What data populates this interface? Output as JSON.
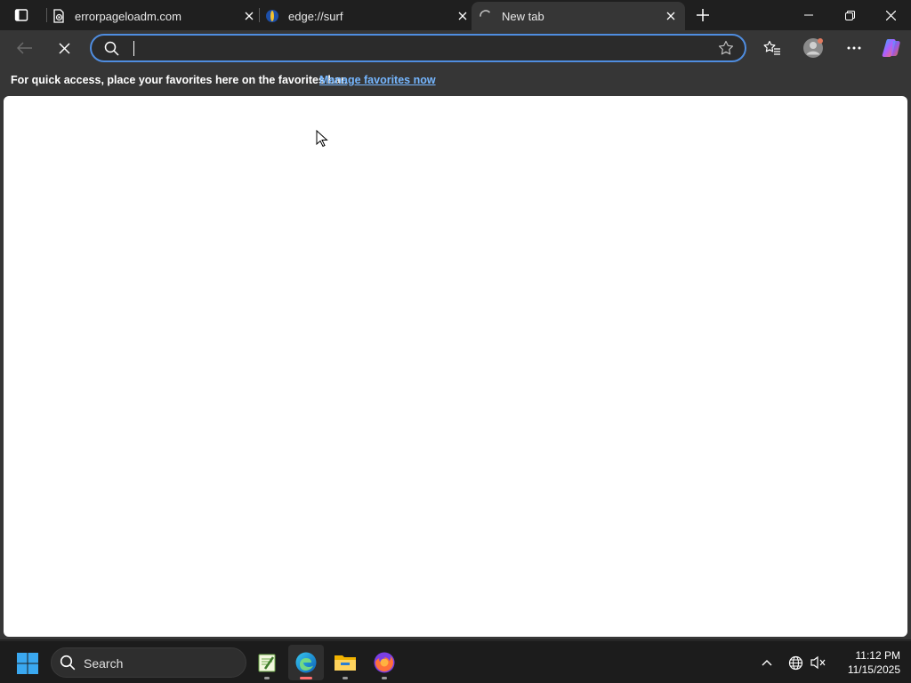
{
  "tabs": [
    {
      "title": "errorpageloadm.com",
      "favicon": "error-page-icon",
      "active": false
    },
    {
      "title": "edge://surf",
      "favicon": "surf-game-icon",
      "active": false
    },
    {
      "title": "New tab",
      "favicon": "loading-spinner-icon",
      "active": true
    }
  ],
  "toolbar": {
    "address_value": "",
    "back_icon": "back-arrow-icon",
    "stop_icon": "stop-loading-icon"
  },
  "favorites_bar": {
    "message": "For quick access, place your favorites here on the favorites bar.",
    "link": "Manage favorites now"
  },
  "taskbar": {
    "search_label": "Search",
    "apps": [
      "notepad-plus-icon",
      "edge-icon",
      "file-explorer-icon",
      "firefox-icon"
    ],
    "time": "11:12 PM",
    "date": "11/15/2025"
  },
  "colors": {
    "accent": "#4f8de0",
    "link": "#75b6ff",
    "tab_active": "#363636",
    "chrome_bg": "#1f1f1f"
  }
}
